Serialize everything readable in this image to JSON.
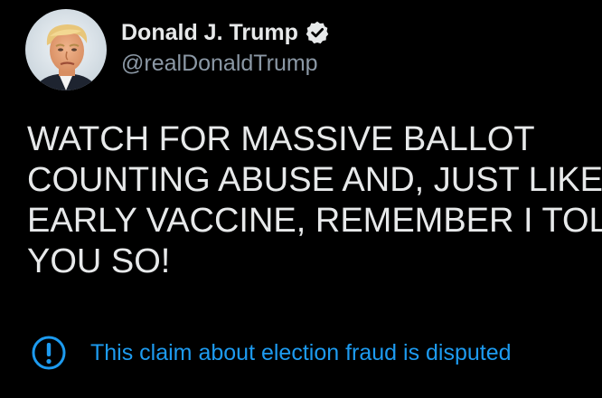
{
  "user": {
    "display_name": "Donald J. Trump",
    "handle": "@realDonaldTrump",
    "verified": true,
    "avatar_icon": "profile-photo"
  },
  "tweet": {
    "lines": [
      "WATCH FOR MASSIVE BALLOT",
      "COUNTING ABUSE AND, JUST LIKE",
      "EARLY VACCINE, REMEMBER I TOL",
      "YOU SO!"
    ]
  },
  "notice": {
    "icon": "alert-circle-icon",
    "text": "This claim about election fraud is disputed"
  },
  "colors": {
    "background": "#000000",
    "text": "#e7e9ea",
    "secondary_text": "#8b98a5",
    "accent": "#1d9bf0"
  }
}
